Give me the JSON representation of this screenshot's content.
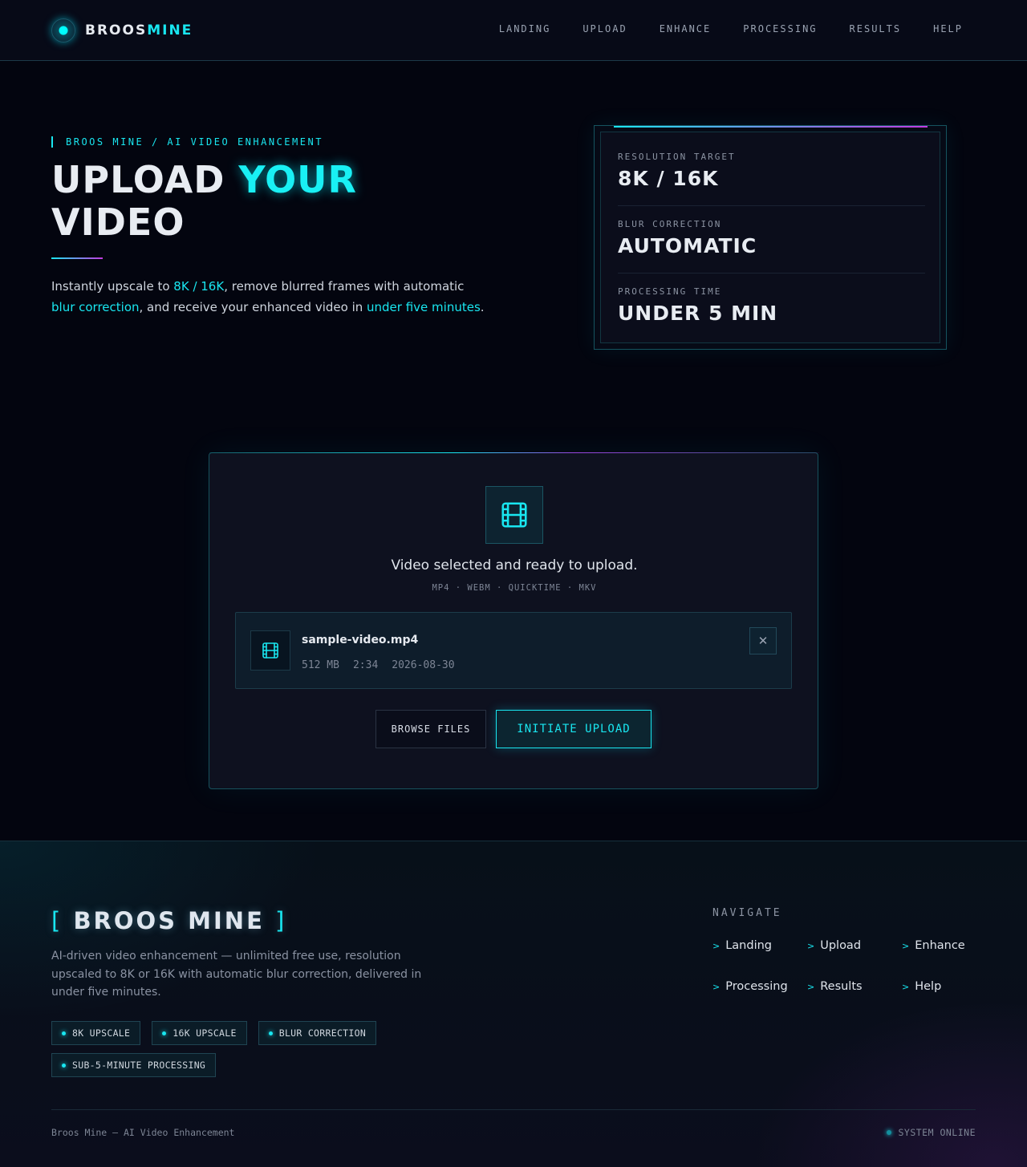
{
  "brand": {
    "name_part1": "BROOS",
    "name_part2": "MINE"
  },
  "nav": {
    "items": [
      {
        "label": "LANDING"
      },
      {
        "label": "UPLOAD"
      },
      {
        "label": "ENHANCE"
      },
      {
        "label": "PROCESSING"
      },
      {
        "label": "RESULTS"
      },
      {
        "label": "HELP"
      }
    ]
  },
  "hero": {
    "eyebrow": "BROOS MINE / AI VIDEO ENHANCEMENT",
    "title_part1": "UPLOAD ",
    "title_accent": "YOUR",
    "title_part2": "VIDEO",
    "desc": {
      "t1": "Instantly upscale to ",
      "h1": "8K / 16K",
      "t2": ", remove blurred frames with automatic ",
      "h2": "blur correction",
      "t3": ", and receive your enhanced video in ",
      "h3": "under five minutes",
      "t4": "."
    }
  },
  "stats": [
    {
      "label": "RESOLUTION TARGET",
      "value": "8K / 16K"
    },
    {
      "label": "BLUR CORRECTION",
      "value": "AUTOMATIC"
    },
    {
      "label": "PROCESSING TIME",
      "value": "UNDER 5 MIN"
    }
  ],
  "upload": {
    "status": "Video selected and ready to upload.",
    "formats": "MP4 · WEBM · QUICKTIME · MKV",
    "file": {
      "name": "sample-video.mp4",
      "size": "512 MB",
      "duration": "2:34",
      "date": "2026-08-30"
    },
    "remove_symbol": "✕",
    "browse_label": "BROWSE FILES",
    "upload_label": "INITIATE UPLOAD"
  },
  "footer": {
    "brand_open": "[",
    "brand": "BROOS MINE",
    "brand_close": "]",
    "desc": "AI-driven video enhancement — unlimited free use, resolution upscaled to 8K or 16K with automatic blur correction, delivered in under five minutes.",
    "tags": [
      {
        "label": "8K UPSCALE"
      },
      {
        "label": "16K UPSCALE"
      },
      {
        "label": "BLUR CORRECTION"
      },
      {
        "label": "SUB-5-MINUTE PROCESSING"
      }
    ],
    "nav_heading": "NAVIGATE",
    "nav_items": [
      {
        "label": "Landing"
      },
      {
        "label": "Upload"
      },
      {
        "label": "Enhance"
      },
      {
        "label": "Processing"
      },
      {
        "label": "Results"
      },
      {
        "label": "Help"
      }
    ],
    "chevron": ">",
    "copyright": "Broos Mine — AI Video Enhancement",
    "status": "SYSTEM ONLINE"
  },
  "colors": {
    "accent": "#19e6f0",
    "accent_secondary": "#c23ce0",
    "background": "#03050f"
  }
}
